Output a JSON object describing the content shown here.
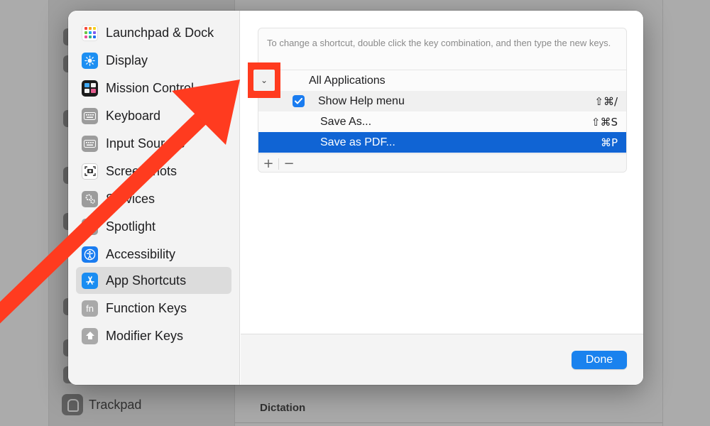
{
  "background": {
    "sidebar_items": [
      {
        "label": "Trackpad",
        "icon": "trackpad-icon"
      }
    ],
    "section_heading": "Dictation"
  },
  "sheet": {
    "sidebar": {
      "items": [
        {
          "label": "Launchpad & Dock",
          "icon": "launchpad-icon",
          "selected": false
        },
        {
          "label": "Display",
          "icon": "display-icon",
          "selected": false
        },
        {
          "label": "Mission Control",
          "icon": "mission-control-icon",
          "selected": false
        },
        {
          "label": "Keyboard",
          "icon": "keyboard-icon",
          "selected": false
        },
        {
          "label": "Input Sources",
          "icon": "input-sources-icon",
          "selected": false
        },
        {
          "label": "Screenshots",
          "icon": "screenshots-icon",
          "selected": false
        },
        {
          "label": "Services",
          "icon": "services-icon",
          "selected": false
        },
        {
          "label": "Spotlight",
          "icon": "spotlight-icon",
          "selected": false
        },
        {
          "label": "Accessibility",
          "icon": "accessibility-icon",
          "selected": false
        },
        {
          "label": "App Shortcuts",
          "icon": "app-shortcuts-icon",
          "selected": true
        },
        {
          "label": "Function Keys",
          "icon": "fn-icon",
          "selected": false
        },
        {
          "label": "Modifier Keys",
          "icon": "modifier-keys-icon",
          "selected": false
        }
      ]
    },
    "hint": "To change a shortcut, double click the key combination, and then type the new keys.",
    "group": {
      "label": "All Applications",
      "expanded": true
    },
    "shortcuts": [
      {
        "name": "Show Help menu",
        "keys": "⇧⌘/",
        "checkbox": true,
        "checked": true,
        "selected": false
      },
      {
        "name": "Save As...",
        "keys": "⇧⌘S",
        "checkbox": false,
        "selected": false
      },
      {
        "name": "Save as PDF...",
        "keys": "⌘P",
        "checkbox": false,
        "selected": true
      }
    ],
    "add_label": "+",
    "remove_label": "−",
    "done_label": "Done"
  },
  "colors": {
    "accent": "#1a82ee",
    "selection": "#1064d4",
    "annotation_red": "#ff3b1f"
  }
}
